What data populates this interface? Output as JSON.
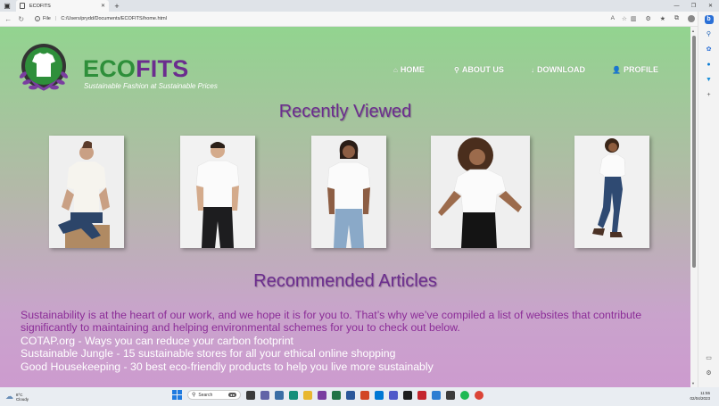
{
  "browser": {
    "tab_title": "ECOFITS",
    "url_label": "File",
    "url": "C:/Users/prydd/Documents/ECOFITS/home.html"
  },
  "site": {
    "brand_eco": "ECO",
    "brand_fits": "FITS",
    "tagline": "Sustainable Fashion at Sustainable Prices",
    "nav": [
      {
        "label": "HOME",
        "icon": "home-icon"
      },
      {
        "label": "ABOUT US",
        "icon": "search-icon"
      },
      {
        "label": "DOWNLOAD",
        "icon": "arrow-down-icon"
      },
      {
        "label": "PROFILE",
        "icon": "user-icon"
      }
    ],
    "recently_viewed_title": "Recently Viewed",
    "products": [
      {
        "name": "man-seated-white-tee"
      },
      {
        "name": "man-white-tee-black-trousers"
      },
      {
        "name": "man-white-tee-jeans"
      },
      {
        "name": "woman-white-cropped-tee"
      },
      {
        "name": "woman-white-tee-jeans"
      }
    ],
    "articles_title": "Recommended Articles",
    "articles_intro": "Sustainability is at the heart of our work, and we hope it is for you to. That’s why we’ve compiled a list of websites that contribute significantly to maintaining and helping environmental schemes for you to check out below.",
    "articles": [
      "COTAP.org - Ways you can reduce your carbon footprint",
      "Sustainable Jungle - 15 sustainable stores for all your ethical online shopping",
      "Good Housekeeping - 30 best eco-friendly products to help you live more sustainably"
    ],
    "colors": {
      "eco_green": "#2e8f3a",
      "fits_purple": "#6b2d8e",
      "intro_text": "#8b2c97"
    }
  },
  "taskbar": {
    "weather_temp": "8°C",
    "weather_desc": "Cloudy",
    "search_placeholder": "Search",
    "time": "11:55",
    "date": "02/04/2023"
  }
}
